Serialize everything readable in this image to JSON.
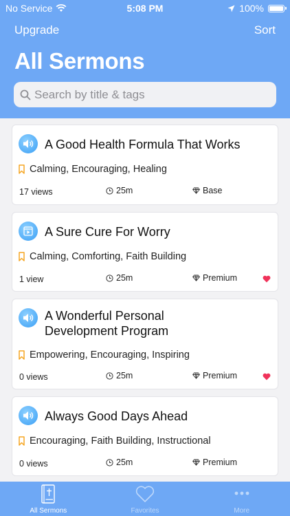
{
  "status_bar": {
    "carrier": "No Service",
    "time": "5:08 PM",
    "battery": "100%"
  },
  "header": {
    "left_action": "Upgrade",
    "right_action": "Sort",
    "title": "All Sermons",
    "search_placeholder": "Search by title & tags"
  },
  "sermons": [
    {
      "icon": "speaker-icon",
      "title": "A Good Health Formula That Works",
      "tags": "Calming, Encouraging, Healing",
      "views": "17 views",
      "duration": "25m",
      "tier": "Base",
      "favorited": false
    },
    {
      "icon": "video-icon",
      "title": "A Sure Cure For Worry",
      "tags": "Calming, Comforting, Faith Building",
      "views": "1 view",
      "duration": "25m",
      "tier": "Premium",
      "favorited": true
    },
    {
      "icon": "speaker-icon",
      "title": "A Wonderful Personal Development Program",
      "tags": "Empowering, Encouraging, Inspiring",
      "views": "0 views",
      "duration": "25m",
      "tier": "Premium",
      "favorited": true
    },
    {
      "icon": "speaker-icon",
      "title": "Always Good Days Ahead",
      "tags": "Encouraging, Faith Building, Instructional",
      "views": "0 views",
      "duration": "25m",
      "tier": "Premium",
      "favorited": false
    }
  ],
  "tabs": [
    {
      "label": "All Sermons",
      "icon": "bible-icon",
      "active": true
    },
    {
      "label": "Favorites",
      "icon": "heart-icon",
      "active": false
    },
    {
      "label": "More",
      "icon": "ellipsis-icon",
      "active": false
    }
  ],
  "colors": {
    "brand": "#6ea8f5",
    "tag_bookmark": "#f5a623",
    "favorite_heart": "#f0325a"
  }
}
